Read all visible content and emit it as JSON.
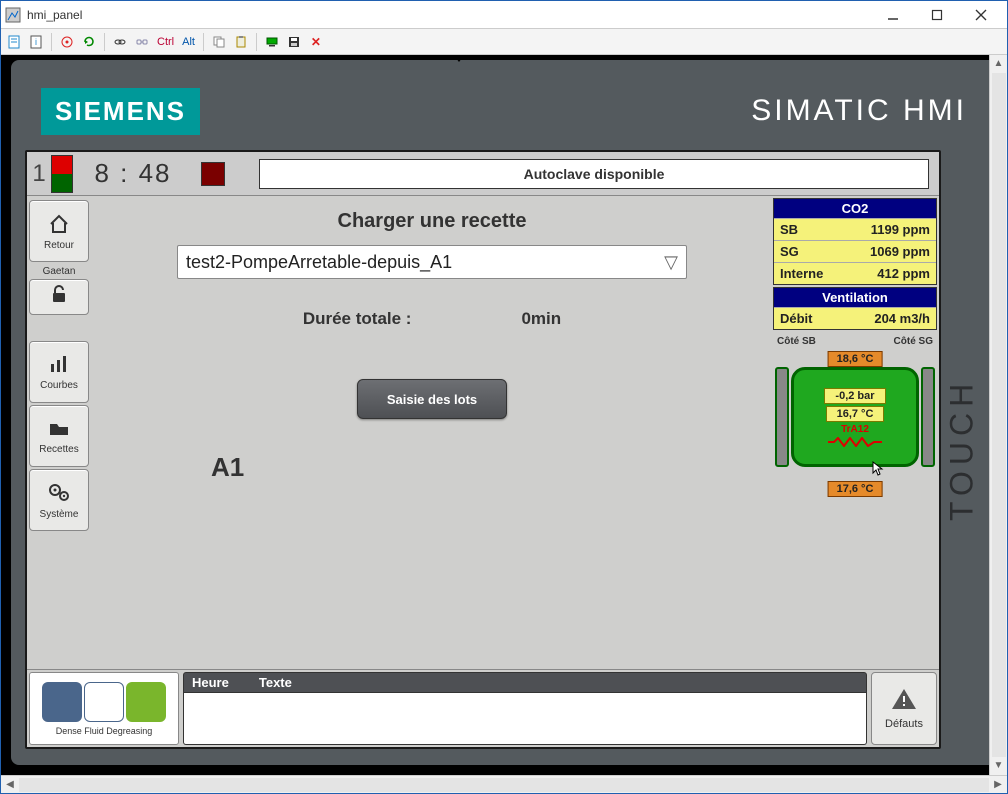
{
  "window": {
    "title": "hmi_panel"
  },
  "toolbar": {
    "ctrl": "Ctrl",
    "alt": "Alt"
  },
  "brand": {
    "siemens": "SIEMENS",
    "simatic": "SIMATIC HMI",
    "touch": "TOUCH"
  },
  "status": {
    "index": "1",
    "time": "8 : 48",
    "message": "Autoclave disponible"
  },
  "sidebar": {
    "back": "Retour",
    "user": "Gaetan",
    "curves": "Courbes",
    "recipes": "Recettes",
    "system": "Système"
  },
  "center": {
    "title": "Charger une recette",
    "recipe": "test2-PompeArretable-depuis_A1",
    "duration_label": "Durée totale :",
    "duration_value": "0min",
    "lots_button": "Saisie des lots",
    "unit_label": "A1"
  },
  "co2": {
    "head": "CO2",
    "sb_label": "SB",
    "sb_value": "1199 ppm",
    "sg_label": "SG",
    "sg_value": "1069 ppm",
    "interne_label": "Interne",
    "interne_value": "412 ppm"
  },
  "vent": {
    "head": "Ventilation",
    "debit_label": "Débit",
    "debit_value": "204 m3/h"
  },
  "sides": {
    "sb": "Côté SB",
    "sg": "Côté SG"
  },
  "autoclave": {
    "temp_top": "18,6 °C",
    "pressure": "-0,2 bar",
    "temp_int": "16,7 °C",
    "tag": "TrA12",
    "temp_bot": "17,6 °C"
  },
  "footer": {
    "dfd": "Dense Fluid Degreasing",
    "alarm_time": "Heure",
    "alarm_text": "Texte",
    "faults": "Défauts"
  },
  "colors": {
    "accent": "#009999",
    "navy": "#000080",
    "yellow": "#f5f27a",
    "orange": "#e58a2a",
    "green": "#1fa81f"
  }
}
